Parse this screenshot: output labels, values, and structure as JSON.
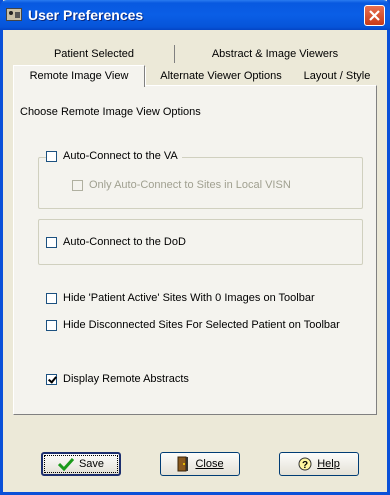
{
  "window": {
    "title": "User Preferences"
  },
  "tabs": {
    "row_back": [
      {
        "label": "Patient Selected"
      },
      {
        "label": "Abstract & Image Viewers"
      }
    ],
    "row_front": [
      {
        "label": "Remote Image View"
      },
      {
        "label": "Alternate Viewer Options"
      },
      {
        "label": "Layout / Style"
      }
    ],
    "active": "Remote Image View"
  },
  "panel": {
    "heading": "Choose Remote Image View Options",
    "auto_connect_va": {
      "label": "Auto-Connect to the VA",
      "checked": false
    },
    "only_local_visn": {
      "label": "Only Auto-Connect to Sites in Local VISN",
      "checked": false,
      "disabled": true
    },
    "auto_connect_dod": {
      "label": "Auto-Connect to the DoD",
      "checked": false
    },
    "hide_patient_active": {
      "label": "Hide 'Patient Active' Sites With 0 Images on Toolbar",
      "checked": false
    },
    "hide_disconnected": {
      "label": "Hide Disconnected Sites For Selected Patient on Toolbar",
      "checked": false
    },
    "display_remote_abstracts": {
      "label": "Display Remote Abstracts",
      "checked": true
    }
  },
  "buttons": {
    "save": "Save",
    "close": "Close",
    "help": "Help"
  },
  "icons": {
    "save": "checkmark-icon",
    "close": "door-icon",
    "help": "help-icon"
  }
}
